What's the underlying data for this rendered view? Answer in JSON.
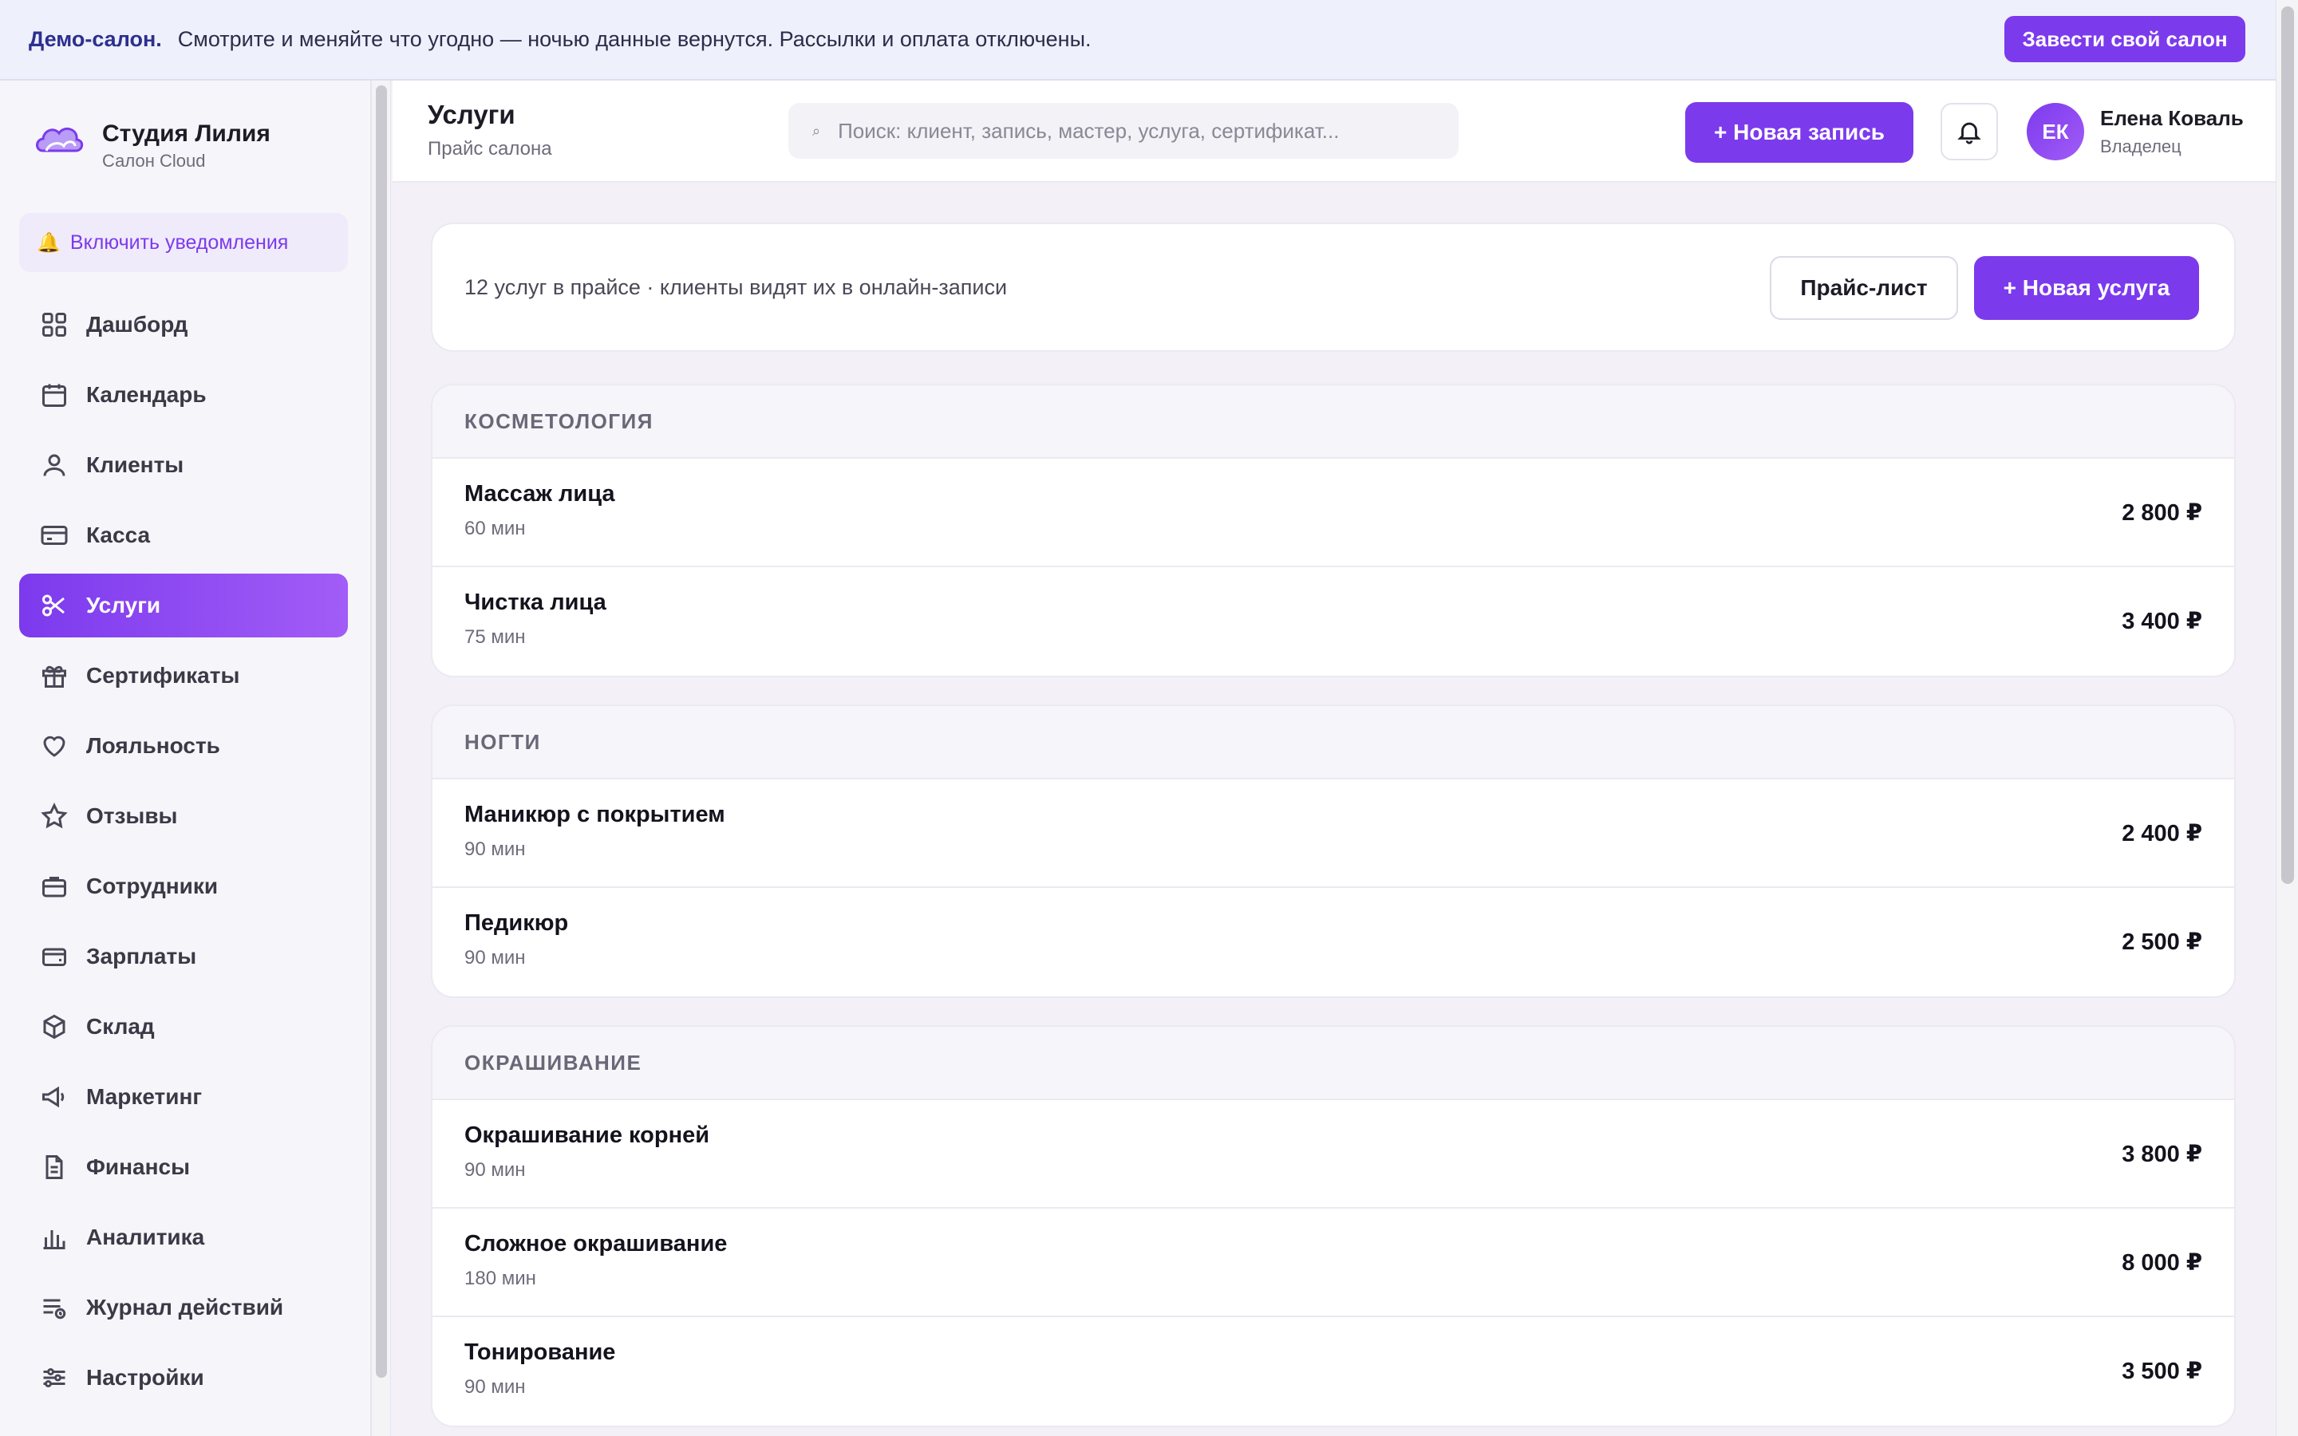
{
  "banner": {
    "strong": "Демо-салон.",
    "text": "Смотрите и меняйте что угодно — ночью данные вернутся. Рассылки и оплата отключены.",
    "button": "Завести свой салон"
  },
  "brand": {
    "name": "Студия Лилия",
    "sub": "Салон Cloud"
  },
  "notify": {
    "label": "Включить уведомления",
    "icon": "bell-icon"
  },
  "nav": [
    {
      "label": "Дашборд",
      "icon": "grid-icon",
      "active": false
    },
    {
      "label": "Календарь",
      "icon": "calendar-icon",
      "active": false
    },
    {
      "label": "Клиенты",
      "icon": "user-icon",
      "active": false
    },
    {
      "label": "Касса",
      "icon": "card-icon",
      "active": false
    },
    {
      "label": "Услуги",
      "icon": "scissors-icon",
      "active": true
    },
    {
      "label": "Сертификаты",
      "icon": "gift-icon",
      "active": false
    },
    {
      "label": "Лояльность",
      "icon": "heart-icon",
      "active": false
    },
    {
      "label": "Отзывы",
      "icon": "star-icon",
      "active": false
    },
    {
      "label": "Сотрудники",
      "icon": "briefcase-icon",
      "active": false
    },
    {
      "label": "Зарплаты",
      "icon": "wallet-icon",
      "active": false
    },
    {
      "label": "Склад",
      "icon": "box-icon",
      "active": false
    },
    {
      "label": "Маркетинг",
      "icon": "megaphone-icon",
      "active": false
    },
    {
      "label": "Финансы",
      "icon": "document-icon",
      "active": false
    },
    {
      "label": "Аналитика",
      "icon": "bar-chart-icon",
      "active": false
    },
    {
      "label": "Журнал действий",
      "icon": "log-icon",
      "active": false
    },
    {
      "label": "Настройки",
      "icon": "sliders-icon",
      "active": false
    }
  ],
  "header": {
    "title": "Услуги",
    "subtitle": "Прайс салона",
    "search_placeholder": "Поиск: клиент, запись, мастер, услуга, сертификат...",
    "new_appointment": "+ Новая запись",
    "user": {
      "initials": "ЕК",
      "name": "Елена Коваль",
      "role": "Владелец"
    }
  },
  "summary": {
    "text": "12 услуг в прайсе · клиенты видят их в онлайн-записи",
    "pricelist_button": "Прайс-лист",
    "new_service_button": "+ Новая услуга"
  },
  "categories": [
    {
      "title": "КОСМЕТОЛОГИЯ",
      "services": [
        {
          "name": "Массаж лица",
          "duration": "60 мин",
          "price": "2 800 ₽"
        },
        {
          "name": "Чистка лица",
          "duration": "75 мин",
          "price": "3 400 ₽"
        }
      ]
    },
    {
      "title": "НОГТИ",
      "services": [
        {
          "name": "Маникюр с покрытием",
          "duration": "90 мин",
          "price": "2 400 ₽"
        },
        {
          "name": "Педикюр",
          "duration": "90 мин",
          "price": "2 500 ₽"
        }
      ]
    },
    {
      "title": "ОКРАШИВАНИЕ",
      "services": [
        {
          "name": "Окрашивание корней",
          "duration": "90 мин",
          "price": "3 800 ₽"
        },
        {
          "name": "Сложное окрашивание",
          "duration": "180 мин",
          "price": "8 000 ₽"
        },
        {
          "name": "Тонирование",
          "duration": "90 мин",
          "price": "3 500 ₽"
        }
      ]
    }
  ],
  "colors": {
    "accent": "#7c3aed",
    "accent_light": "#a25cf7",
    "banner_bg": "#eef0fb"
  }
}
